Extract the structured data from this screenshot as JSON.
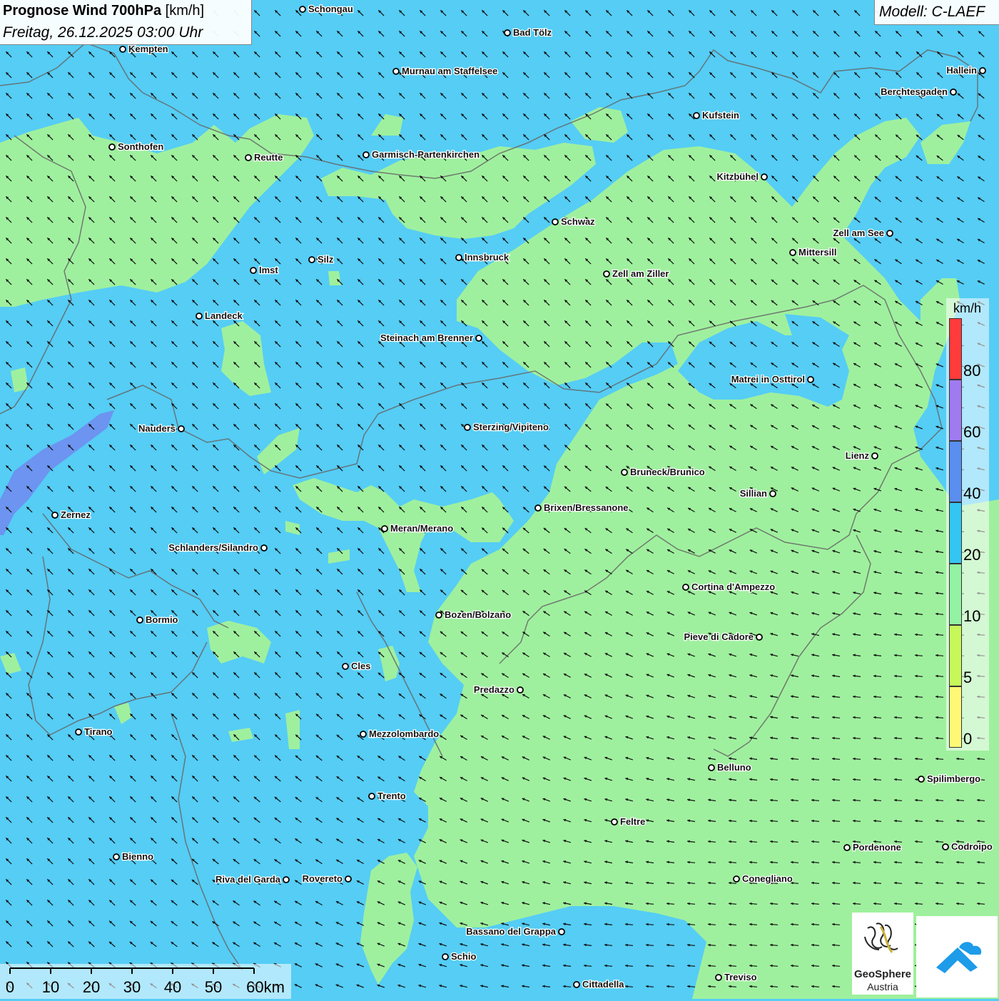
{
  "title": {
    "main_bold": "Prognose Wind 700hPa",
    "main_unit": " [km/h]",
    "date": "Freitag, 26.12.2025 03:00 Uhr"
  },
  "model": "Modell: C-LAEF",
  "legend": {
    "unit": "km/h",
    "labels": [
      "80",
      "60",
      "40",
      "20",
      "10",
      "5",
      "0"
    ],
    "colors": [
      "#ff3b3b",
      "#a07bf0",
      "#5a8ff0",
      "#33c6f2",
      "#93f2a4",
      "#c8f75a",
      "#fff877"
    ]
  },
  "scalebar": {
    "labels": [
      "0",
      "10",
      "20",
      "30",
      "40",
      "50",
      "60km"
    ]
  },
  "colors": {
    "wind_blue": "#55cdf5",
    "wind_green": "#9ff09e",
    "wind_violet": "#6f8ef0"
  },
  "places": [
    {
      "name": "Schongau"
    },
    {
      "name": "Bad Tölz"
    },
    {
      "name": "Kempten"
    },
    {
      "name": "Murnau am Staffelsee"
    },
    {
      "name": "Hallein"
    },
    {
      "name": "Berchtesgaden"
    },
    {
      "name": "Kufstein"
    },
    {
      "name": "Sonthofen"
    },
    {
      "name": "Reutte"
    },
    {
      "name": "Garmisch-Partenkirchen"
    },
    {
      "name": "Kitzbühel"
    },
    {
      "name": "Schwaz"
    },
    {
      "name": "Zell am See"
    },
    {
      "name": "Mittersill"
    },
    {
      "name": "Silz"
    },
    {
      "name": "Imst"
    },
    {
      "name": "Innsbruck"
    },
    {
      "name": "Zell am Ziller"
    },
    {
      "name": "Landeck"
    },
    {
      "name": "Steinach am Brenner"
    },
    {
      "name": "Matrei in Osttirol"
    },
    {
      "name": "Nauders"
    },
    {
      "name": "Sterzing/Vipiteno"
    },
    {
      "name": "Lienz"
    },
    {
      "name": "Bruneck/Brunico"
    },
    {
      "name": "Sillian"
    },
    {
      "name": "Zernez"
    },
    {
      "name": "Brixen/Bressanone"
    },
    {
      "name": "Meran/Merano"
    },
    {
      "name": "Schlanders/Silandro"
    },
    {
      "name": "Cortina d'Ampezzo"
    },
    {
      "name": "Bozen/Bolzano"
    },
    {
      "name": "Bormio"
    },
    {
      "name": "Pieve di Cadore"
    },
    {
      "name": "Cles"
    },
    {
      "name": "Predazzo"
    },
    {
      "name": "Tirano"
    },
    {
      "name": "Mezzolombardo"
    },
    {
      "name": "Belluno"
    },
    {
      "name": "Spilimbergo"
    },
    {
      "name": "Trento"
    },
    {
      "name": "Feltre"
    },
    {
      "name": "Bienno"
    },
    {
      "name": "Pordenone"
    },
    {
      "name": "Codroipo"
    },
    {
      "name": "Riva del Garda"
    },
    {
      "name": "Rovereto"
    },
    {
      "name": "Conegliano"
    },
    {
      "name": "Bassano del Grappa"
    },
    {
      "name": "Schio"
    },
    {
      "name": "Treviso"
    },
    {
      "name": "Cittadella"
    }
  ],
  "logos": {
    "geosphere_line1": "GeoSphere",
    "geosphere_line2": "Austria"
  }
}
